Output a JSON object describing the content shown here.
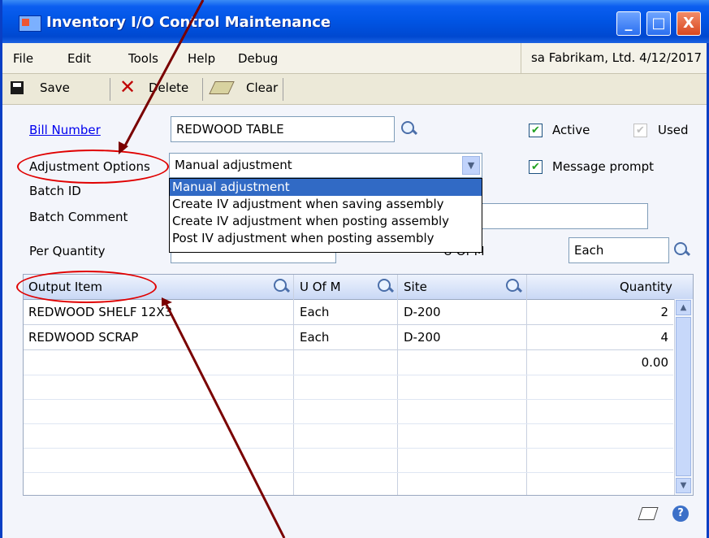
{
  "window": {
    "title": "Inventory I/O Control Maintenance",
    "minimize": "_",
    "maximize": "□",
    "close": "X"
  },
  "menu": {
    "items": [
      "File",
      "Edit",
      "Tools",
      "Help",
      "Debug"
    ],
    "status": "sa  Fabrikam, Ltd.  4/12/2017"
  },
  "toolbar": {
    "save": "Save",
    "delete": "Delete",
    "clear": "Clear"
  },
  "form": {
    "bill_number_label": "Bill Number",
    "bill_number_value": "REDWOOD TABLE",
    "active_label": "Active",
    "active_checked": true,
    "used_label": "Used",
    "used_checked": true,
    "adjustment_options_label": "Adjustment Options",
    "adjustment_options_value": "Manual adjustment",
    "message_prompt_label": "Message prompt",
    "message_prompt_checked": true,
    "batch_id_label": "Batch ID",
    "batch_comment_label": "Batch Comment",
    "per_quantity_label": "Per Quantity",
    "uofm_label": "U Of M",
    "uofm_value": "Each",
    "adjustment_options_list": [
      "Manual adjustment",
      "Create IV adjustment when saving assembly",
      "Create IV adjustment when posting assembly",
      "Post IV adjustment when posting assembly"
    ]
  },
  "grid": {
    "headers": {
      "output_item": "Output Item",
      "uofm": "U Of M",
      "site": "Site",
      "quantity": "Quantity"
    },
    "rows": [
      {
        "item": "REDWOOD SHELF 12X3",
        "uofm": "Each",
        "site": "D-200",
        "quantity": "2"
      },
      {
        "item": "REDWOOD SCRAP",
        "uofm": "Each",
        "site": "D-200",
        "quantity": "4"
      },
      {
        "item": "",
        "uofm": "",
        "site": "",
        "quantity": "0.00"
      }
    ]
  },
  "icons": [
    "save-icon",
    "delete-icon",
    "clear-icon",
    "lookup-icon",
    "dropdown-arrow-icon",
    "note-icon",
    "help-icon"
  ],
  "colors": {
    "titlebar": "#0054e3",
    "form_background": "#f3f5fb",
    "selection": "#316ac5",
    "annotation": "#e00000",
    "arrow": "#7a0000"
  }
}
